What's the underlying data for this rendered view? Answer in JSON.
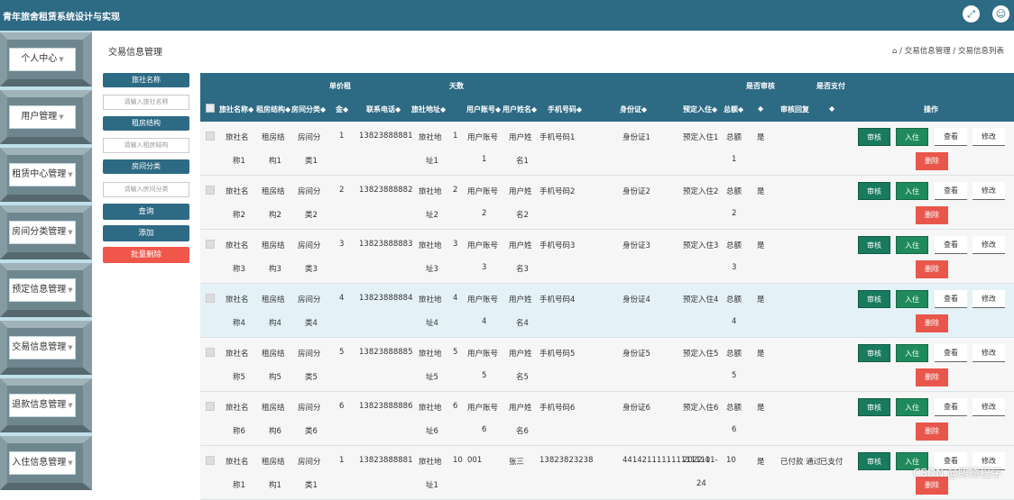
{
  "app": {
    "title": "青年旅舍租赁系统设计与实现"
  },
  "topbar": {
    "fullscreen_icon": "expand-icon",
    "user_icon": "user-icon"
  },
  "sidebar": {
    "items": [
      {
        "label": "个人中心"
      },
      {
        "label": "用户管理"
      },
      {
        "label": "租赁中心管理"
      },
      {
        "label": "房间分类管理"
      },
      {
        "label": "预定信息管理"
      },
      {
        "label": "交易信息管理"
      },
      {
        "label": "退款信息管理"
      },
      {
        "label": "入住信息管理"
      }
    ]
  },
  "page": {
    "title": "交易信息管理",
    "breadcrumb": {
      "home_icon": "home-icon",
      "level1": "交易信息管理",
      "separator": "/",
      "level2": "交易信息列表"
    }
  },
  "filters": {
    "hotel_name": {
      "label": "旅社名称",
      "placeholder": "请输入旅社名称"
    },
    "structure": {
      "label": "租房结构",
      "placeholder": "请输入租房结构"
    },
    "room_type": {
      "label": "房间分类",
      "placeholder": "请输入房间分类"
    },
    "query_button": "查询",
    "add_button": "添加",
    "batch_delete_button": "批量删除"
  },
  "table": {
    "header_top": {
      "unit_rent": "单价租",
      "days": "天数",
      "audit": "是否审核",
      "paid": "是否支付"
    },
    "headers": {
      "hotel_name": "旅社名称◆",
      "structure": "租房结构◆",
      "room_type": "房间分类◆",
      "price": "金◆",
      "phone": "联系电话◆",
      "address": "旅社地址◆",
      "account": "用户账号◆",
      "username": "用户姓名◆",
      "mobile": "手机号码◆",
      "idcard": "身份证◆",
      "reserve": "预定入住◆",
      "total": "总额◆",
      "sort": "◆",
      "reply": "审核回复",
      "sort2": "◆",
      "ops": "操作"
    },
    "ops": {
      "audit": "审核",
      "checkin": "入住",
      "view": "查看",
      "edit": "修改",
      "delete": "删除"
    },
    "rows": [
      {
        "hotel_a": "旅社名",
        "hotel_b": "称1",
        "struct_a": "租房结",
        "struct_b": "构1",
        "type_a": "房间分",
        "type_b": "类1",
        "price": "1",
        "phone": "13823888881",
        "addr_a": "旅社地",
        "addr_b": "址1",
        "days": "1",
        "acct_a": "用户账号",
        "acct_b": "1",
        "name_a": "用户姓",
        "name_b": "名1",
        "mobile": "手机号码1",
        "idcard": "身份证1",
        "reserve_a": "预定入住1",
        "reserve_b": "",
        "total_a": "总额",
        "total_b": "1",
        "audit": "是",
        "reply": "",
        "paid": ""
      },
      {
        "hotel_a": "旅社名",
        "hotel_b": "称2",
        "struct_a": "租房结",
        "struct_b": "构2",
        "type_a": "房间分",
        "type_b": "类2",
        "price": "2",
        "phone": "13823888882",
        "addr_a": "旅社地",
        "addr_b": "址2",
        "days": "2",
        "acct_a": "用户账号",
        "acct_b": "2",
        "name_a": "用户姓",
        "name_b": "名2",
        "mobile": "手机号码2",
        "idcard": "身份证2",
        "reserve_a": "预定入住2",
        "reserve_b": "",
        "total_a": "总额",
        "total_b": "2",
        "audit": "是",
        "reply": "",
        "paid": ""
      },
      {
        "hotel_a": "旅社名",
        "hotel_b": "称3",
        "struct_a": "租房结",
        "struct_b": "构3",
        "type_a": "房间分",
        "type_b": "类3",
        "price": "3",
        "phone": "13823888883",
        "addr_a": "旅社地",
        "addr_b": "址3",
        "days": "3",
        "acct_a": "用户账号",
        "acct_b": "3",
        "name_a": "用户姓",
        "name_b": "名3",
        "mobile": "手机号码3",
        "idcard": "身份证3",
        "reserve_a": "预定入住3",
        "reserve_b": "",
        "total_a": "总额",
        "total_b": "3",
        "audit": "是",
        "reply": "",
        "paid": ""
      },
      {
        "hotel_a": "旅社名",
        "hotel_b": "称4",
        "struct_a": "租房结",
        "struct_b": "构4",
        "type_a": "房间分",
        "type_b": "类4",
        "price": "4",
        "phone": "13823888884",
        "addr_a": "旅社地",
        "addr_b": "址4",
        "days": "4",
        "acct_a": "用户账号",
        "acct_b": "4",
        "name_a": "用户姓",
        "name_b": "名4",
        "mobile": "手机号码4",
        "idcard": "身份证4",
        "reserve_a": "预定入住4",
        "reserve_b": "",
        "total_a": "总额",
        "total_b": "4",
        "audit": "是",
        "reply": "",
        "paid": ""
      },
      {
        "hotel_a": "旅社名",
        "hotel_b": "称5",
        "struct_a": "租房结",
        "struct_b": "构5",
        "type_a": "房间分",
        "type_b": "类5",
        "price": "5",
        "phone": "13823888885",
        "addr_a": "旅社地",
        "addr_b": "址5",
        "days": "5",
        "acct_a": "用户账号",
        "acct_b": "5",
        "name_a": "用户姓",
        "name_b": "名5",
        "mobile": "手机号码5",
        "idcard": "身份证5",
        "reserve_a": "预定入住5",
        "reserve_b": "",
        "total_a": "总额",
        "total_b": "5",
        "audit": "是",
        "reply": "",
        "paid": ""
      },
      {
        "hotel_a": "旅社名",
        "hotel_b": "称6",
        "struct_a": "租房结",
        "struct_b": "构6",
        "type_a": "房间分",
        "type_b": "类6",
        "price": "6",
        "phone": "13823888886",
        "addr_a": "旅社地",
        "addr_b": "址6",
        "days": "6",
        "acct_a": "用户账号",
        "acct_b": "6",
        "name_a": "用户姓",
        "name_b": "名6",
        "mobile": "手机号码6",
        "idcard": "身份证6",
        "reserve_a": "预定入住6",
        "reserve_b": "",
        "total_a": "总额",
        "total_b": "6",
        "audit": "是",
        "reply": "",
        "paid": ""
      },
      {
        "hotel_a": "旅社名",
        "hotel_b": "称1",
        "struct_a": "租房结",
        "struct_b": "构1",
        "type_a": "房间分",
        "type_b": "类1",
        "price": "1",
        "phone": "13823888881",
        "addr_a": "旅社地",
        "addr_b": "址1",
        "days": "10",
        "acct_a": "001",
        "acct_b": "",
        "name_a": "张三",
        "name_b": "",
        "mobile": "13823823238",
        "idcard": "441421111111111111",
        "reserve_a": "2022-01-",
        "reserve_b": "24",
        "total_a": "10",
        "total_b": "",
        "audit": "是",
        "reply": "已付款 通过",
        "paid": "已支付"
      }
    ]
  },
  "watermark": "CSDN @腾德程序",
  "colors": {
    "primary": "#2d6a84",
    "audit_btn": "#1a7a5e",
    "delete_btn": "#e8564c",
    "batch_delete": "#f0564a",
    "sidebar_bg": "#bfe0ea"
  }
}
